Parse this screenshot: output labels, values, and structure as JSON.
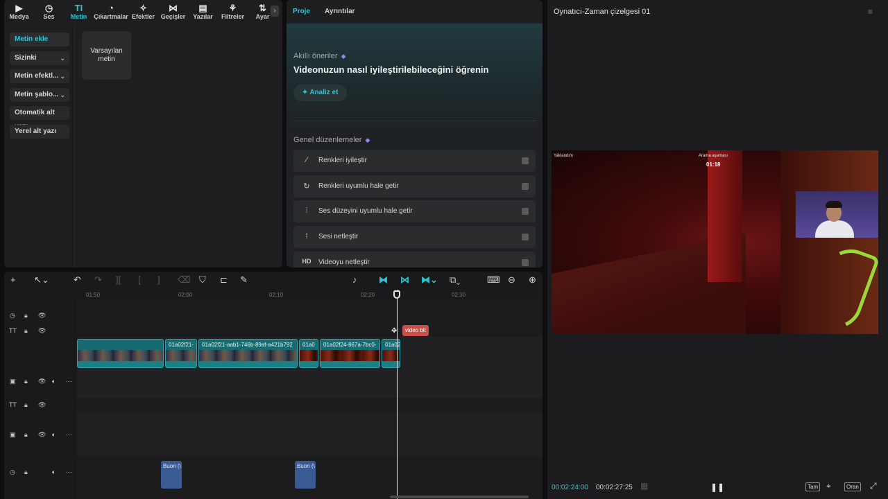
{
  "top_tabs": [
    {
      "label": "Medya",
      "icon": "media-icon"
    },
    {
      "label": "Ses",
      "icon": "audio-icon"
    },
    {
      "label": "Metin",
      "icon": "text-icon"
    },
    {
      "label": "Çıkartmalar",
      "icon": "sticker-icon"
    },
    {
      "label": "Efektler",
      "icon": "effects-icon"
    },
    {
      "label": "Geçişler",
      "icon": "transitions-icon"
    },
    {
      "label": "Yazılar",
      "icon": "captions-icon"
    },
    {
      "label": "Filtreler",
      "icon": "filters-icon"
    },
    {
      "label": "Ayar",
      "icon": "adjust-icon"
    }
  ],
  "sidebar": {
    "items": [
      {
        "label": "Metin ekle"
      },
      {
        "label": "Sizinki"
      },
      {
        "label": "Metin efektl..."
      },
      {
        "label": "Metin şablo..."
      },
      {
        "label": "Otomatik alt yazı"
      },
      {
        "label": "Yerel alt yazı"
      }
    ]
  },
  "library": {
    "default_text_card": "Varsayılan metin"
  },
  "project_panel": {
    "tabs": [
      "Proje",
      "Ayrıntılar"
    ],
    "smart_label": "Akıllı öneriler",
    "headline": "Videonuzun nasıl iyileştirilebileceğini öğrenin",
    "analyze_button": "Analiz et",
    "general_label": "Genel düzenlemeler",
    "options": [
      {
        "label": "Renkleri iyileştir",
        "icon": "magic-wand-icon"
      },
      {
        "label": "Renkleri uyumlu hale getir",
        "icon": "color-match-icon"
      },
      {
        "label": "Ses düzeyini uyumlu hale getir",
        "icon": "sliders-icon"
      },
      {
        "label": "Sesi netleştir",
        "icon": "waveform-icon"
      },
      {
        "label": "Videoyu netleştir",
        "icon": "hd-icon"
      }
    ]
  },
  "player": {
    "title": "Oynatıcı-Zaman çizelgesi 01",
    "overlay_left": "Yaklandım",
    "overlay_right": "Arama aşaması",
    "overlay_timer": "01:18",
    "current_time": "00:02:24:00",
    "total_time": "00:02:27:25",
    "btn_full": "Tam",
    "btn_ratio": "Oran"
  },
  "timeline": {
    "ruler_ticks": [
      "01:50",
      "02:00",
      "02:10",
      "02:20",
      "02:30"
    ],
    "clips": [
      {
        "label": ""
      },
      {
        "label": "01a02f21-"
      },
      {
        "label": "01a02f21-aab1-746b-89af-a421b792"
      },
      {
        "label": "01a0"
      },
      {
        "label": "01a02f24-867a-7bc0-"
      },
      {
        "label": "01a02"
      }
    ],
    "marker": "video bit",
    "audio_clips": [
      {
        "label": "Buon (\\"
      },
      {
        "label": "Buon (\\"
      }
    ]
  },
  "colors": {
    "accent": "#2bc7d3",
    "clip": "#166a70",
    "audio": "#3a5a94",
    "marker": "#c9504a"
  }
}
